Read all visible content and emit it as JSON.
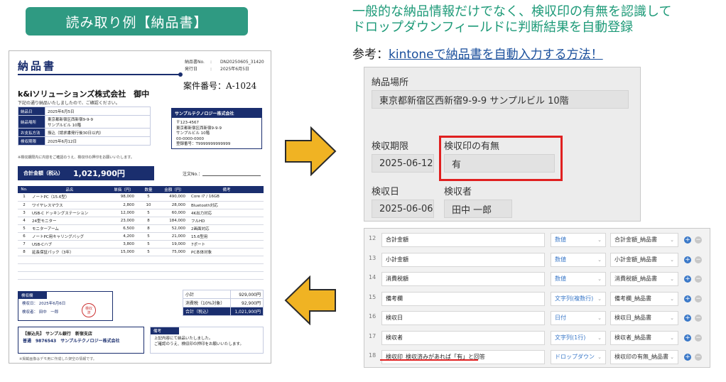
{
  "banner": {
    "title": "読み取り例【納品書】"
  },
  "description": {
    "line1": "一般的な納品情報だけでなく、検収印の有無を認識して",
    "line2": "ドロップダウンフィールドに判断結果を自動登録"
  },
  "reference": {
    "prefix": "参考：",
    "link": "kintoneで納品書を自動入力する方法！"
  },
  "invoice": {
    "title": "納品書",
    "meta": [
      {
        "label": "納品書No.",
        "sep": ":",
        "value": "DN20250605_31420"
      },
      {
        "label": "発行日",
        "sep": ":",
        "value": "2025年6月5日"
      }
    ],
    "case_number": "案件番号：A-1024",
    "company": "k&iソリューションズ株式会社　御中",
    "company_note": "下記の通り納品いたしましたので、ご確認ください。",
    "info": [
      {
        "key": "納品日",
        "value": "2025年6月5日"
      },
      {
        "key": "納品場所",
        "value": "東京都新宿区西新宿9-9-9",
        "value2": "サンプルビル 10階"
      },
      {
        "key": "お支払方法",
        "value": "振込（請求書発行後30日以内）"
      },
      {
        "key": "検収期限",
        "value": "2025年6月12日"
      }
    ],
    "inspection_note": "※検収期限内に内容をご確認のうえ、検収印の押印をお願いいたします。",
    "vendor": {
      "name": "サンプルテクノロジー株式会社",
      "lines": [
        "〒123-4567",
        "東京都新宿区西新宿9-9-9",
        "サンプルビル 10階",
        "00-0000-0000",
        "登録番号：T9999999999999"
      ]
    },
    "total": {
      "label": "合計金額（税込）",
      "value": "1,021,900円"
    },
    "order_no_label": "注文No.：",
    "items_headers": [
      "No.",
      "品名",
      "単価（円）",
      "数量",
      "金額（円）",
      "備考"
    ],
    "items": [
      {
        "no": "1",
        "name": "ノートPC（15.6型）",
        "price": "98,000",
        "qty": "5",
        "amount": "490,000",
        "note": "Core i7 / 16GB"
      },
      {
        "no": "2",
        "name": "ワイヤレスマウス",
        "price": "2,800",
        "qty": "10",
        "amount": "28,000",
        "note": "Bluetooth対応"
      },
      {
        "no": "3",
        "name": "USB-C ドッキングステーション",
        "price": "12,000",
        "qty": "5",
        "amount": "60,000",
        "note": "4K出力対応"
      },
      {
        "no": "4",
        "name": "24型モニター",
        "price": "23,000",
        "qty": "8",
        "amount": "184,000",
        "note": "フルHD"
      },
      {
        "no": "5",
        "name": "モニターアーム",
        "price": "6,500",
        "qty": "8",
        "amount": "52,000",
        "note": "2画面対応"
      },
      {
        "no": "6",
        "name": "ノートPC用キャリングバッグ",
        "price": "4,200",
        "qty": "5",
        "amount": "21,000",
        "note": "15.6型用"
      },
      {
        "no": "7",
        "name": "USB-Cハブ",
        "price": "3,800",
        "qty": "5",
        "amount": "19,000",
        "note": "7ポート"
      },
      {
        "no": "8",
        "name": "延長保証パック（3年）",
        "price": "15,000",
        "qty": "5",
        "amount": "75,000",
        "note": "PC本体対象"
      }
    ],
    "inspection": {
      "header": "検収欄",
      "date_label": "検収日：",
      "date_value": "2025年6月6日",
      "inspector_label": "検収者：",
      "inspector_value": "田中　一郎",
      "stamp_line1": "検収",
      "stamp_line2": "済"
    },
    "summary": [
      {
        "label": "小計",
        "value": "929,000円"
      },
      {
        "label": "消費税（10%対象）",
        "value": "92,900円"
      },
      {
        "label": "合計（税込）",
        "value": "1,021,900円"
      }
    ],
    "bank": {
      "line1": "【振込先】 サンプル銀行　新宿支店",
      "line2": "普通　9876543　サンプルテクノロジー株式会社"
    },
    "remarks": {
      "header": "備考",
      "line1": "上記内容にて納品いたしました。",
      "line2": "ご確認のうえ、検収印の押印をお願いいたします。"
    },
    "footnote": "※掲載画像はデモ用に作成した架空の情報です。"
  },
  "form": {
    "delivery_place_label": "納品場所",
    "delivery_place_value": "東京都新宿区西新宿9-9-9 サンプルビル 10階",
    "deadline_label": "検収期限",
    "deadline_value": "2025-06-12",
    "stamp_label": "検収印の有無",
    "stamp_value": "有",
    "inspect_date_label": "検収日",
    "inspect_date_value": "2025-06-06",
    "inspector_label": "検収者",
    "inspector_value": "田中 一郎"
  },
  "field_table": [
    {
      "num": "12",
      "name": "合計金額",
      "type": "数値",
      "field": "合計金額_納品書"
    },
    {
      "num": "13",
      "name": "小計金額",
      "type": "数値",
      "field": "小計金額_納品書"
    },
    {
      "num": "14",
      "name": "消費税額",
      "type": "数値",
      "field": "消費税額_納品書"
    },
    {
      "num": "15",
      "name": "備考欄",
      "type": "文字列(複数行)",
      "field": "備考欄_納品書"
    },
    {
      "num": "16",
      "name": "検収日",
      "type": "日付",
      "field": "検収日_納品書"
    },
    {
      "num": "17",
      "name": "検収者",
      "type": "文字列(1行)",
      "field": "検収者_納品書"
    },
    {
      "num": "18",
      "name": "検収印_検収済みがあれば「有」と回答",
      "type": "ドロップダウン",
      "field": "検収印の有無_納品書"
    }
  ],
  "colors": {
    "accent": "#2f9a82",
    "navy": "#1a2e6e",
    "highlight": "#e02020",
    "arrow": "#f0b323"
  }
}
